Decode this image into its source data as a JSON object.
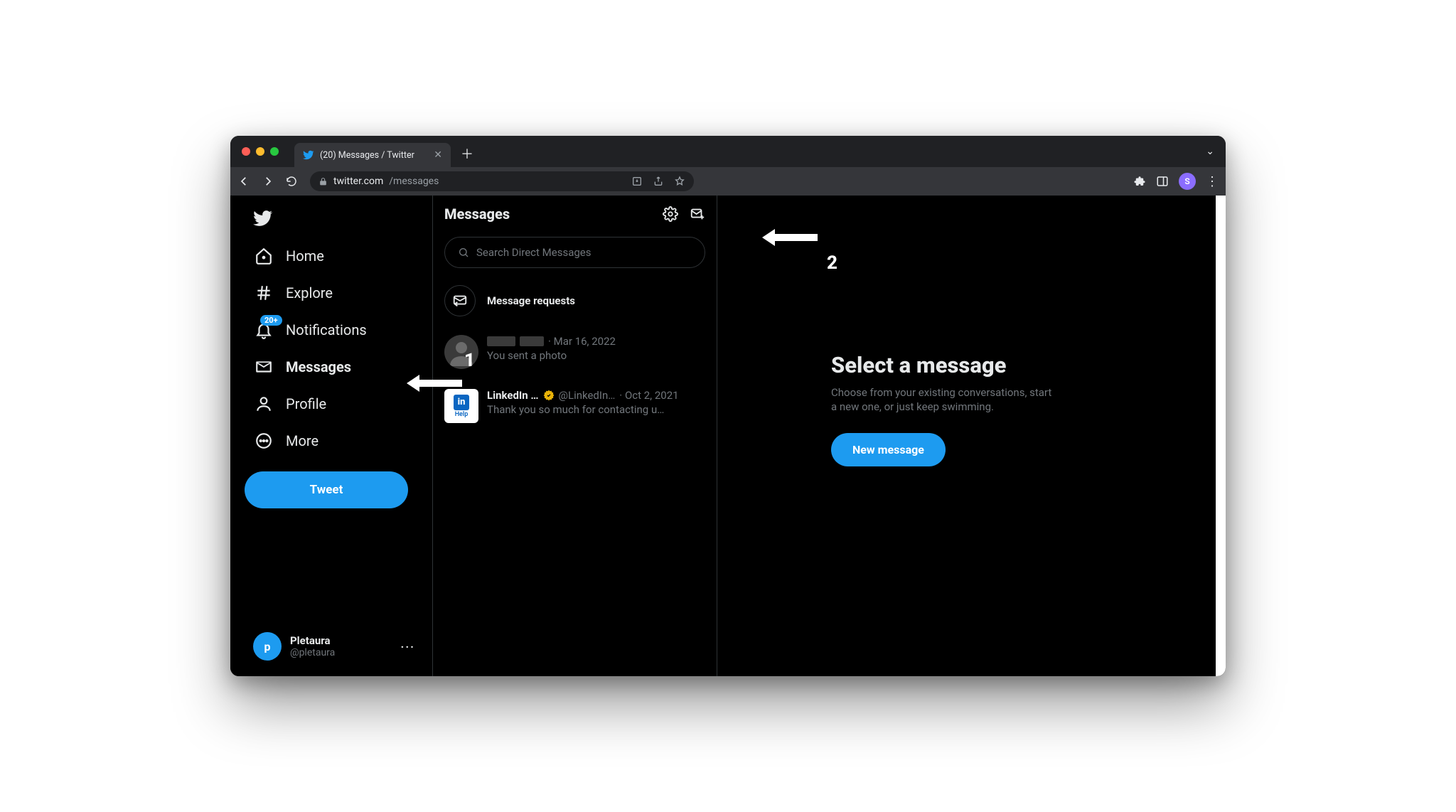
{
  "browser": {
    "tab_title": "(20) Messages / Twitter",
    "url_domain": "twitter.com",
    "url_path": "/messages",
    "profile_initial": "S"
  },
  "sidebar": {
    "items": [
      {
        "label": "Home"
      },
      {
        "label": "Explore"
      },
      {
        "label": "Notifications",
        "badge": "20+"
      },
      {
        "label": "Messages"
      },
      {
        "label": "Profile"
      },
      {
        "label": "More"
      }
    ],
    "tweet_label": "Tweet",
    "account": {
      "name": "Pletaura",
      "handle": "@pletaura",
      "initial": "p"
    }
  },
  "messages": {
    "title": "Messages",
    "search_placeholder": "Search Direct Messages",
    "requests_label": "Message requests",
    "conversations": [
      {
        "name": "",
        "handle": "",
        "date": "Mar 16, 2022",
        "preview": "You sent a photo",
        "avatar": "blank",
        "verified": false
      },
      {
        "name": "LinkedIn …",
        "handle": "@LinkedIn…",
        "date": "Oct 2, 2021",
        "preview": "Thank you so much for contacting u…",
        "avatar": "linkedin-help",
        "verified": true
      }
    ]
  },
  "main": {
    "title": "Select a message",
    "body": "Choose from your existing conversations, start a new one, or just keep swimming.",
    "button": "New message"
  },
  "annotations": {
    "one": "1",
    "two": "2"
  },
  "linkedin_help_text": "Help",
  "linkedin_in_text": "in"
}
